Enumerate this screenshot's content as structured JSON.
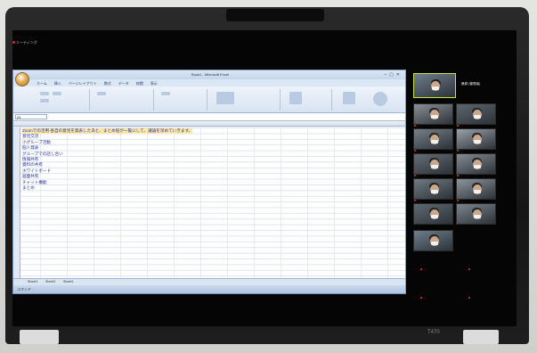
{
  "meeting": {
    "title": "ミーティング"
  },
  "excel": {
    "window_title": "Book1 - Microsoft Excel",
    "tabs": [
      "ホーム",
      "挿入",
      "ページレイアウト",
      "数式",
      "データ",
      "校閲",
      "表示"
    ],
    "name_box": "A1",
    "formula_text": "",
    "rows": [
      "Zoomでの活用   各自の意見を発表したあと、まとめ役が一覧にして、議論を深めていきます。",
      "意見交流",
      "小グループ活動",
      "個人発表",
      "グループでの話し合い",
      "情報共有",
      "資料の共有",
      "ホワイトボード",
      "画面共有",
      "チャット機能",
      "まとめ"
    ],
    "sheets": [
      "Sheet1",
      "Sheet2",
      "Sheet3"
    ],
    "status": "コマンド"
  },
  "participants": {
    "speaker_name": "桑原 (管理者)",
    "names": [
      "",
      "",
      "",
      "",
      "",
      "",
      "",
      "",
      "",
      "",
      "",
      "",
      "",
      "",
      "",
      ""
    ],
    "row_labels": [
      "",
      "",
      ""
    ]
  },
  "colors": {
    "excel_blue": "#1f2f9e",
    "selection": "#ffe9a8",
    "mic_muted": "#e53030"
  },
  "device": {
    "brand": "T470"
  }
}
